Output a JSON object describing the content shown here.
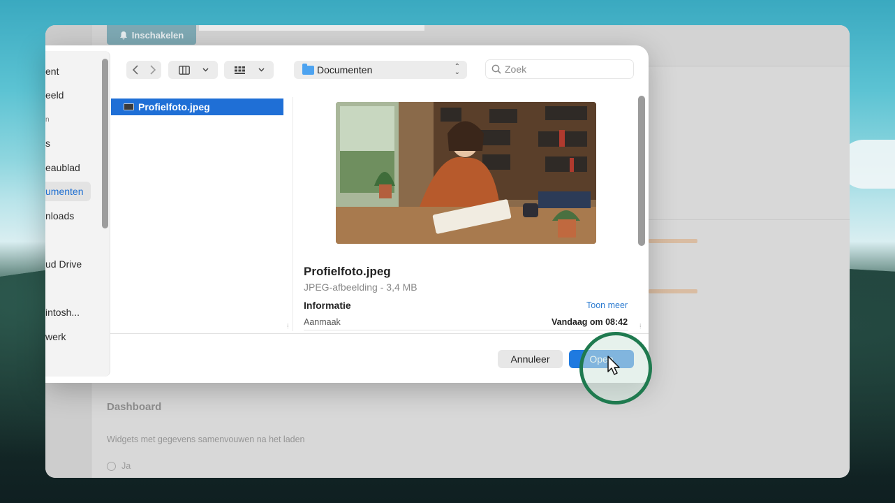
{
  "background_app": {
    "enable_button": "Inschakelen",
    "dashboard_title": "Dashboard",
    "dashboard_desc": "Widgets met gegevens samenvouwen na het laden",
    "radio_option": "Ja"
  },
  "dialog": {
    "sidebar": {
      "items": [
        {
          "label": "ent"
        },
        {
          "label": "eeld"
        },
        {
          "label": "n"
        },
        {
          "label": "s"
        },
        {
          "label": "eaublad"
        },
        {
          "label": "umenten",
          "active": true
        },
        {
          "label": "nloads"
        },
        {
          "label": "ud Drive"
        },
        {
          "label": "intosh..."
        },
        {
          "label": "werk"
        }
      ]
    },
    "toolbar": {
      "back_icon": "chevron-left-icon",
      "forward_icon": "chevron-right-icon",
      "view_icon": "columns-view-icon",
      "group_icon": "grid-icon"
    },
    "location": {
      "label": "Documenten"
    },
    "search": {
      "placeholder": "Zoek"
    },
    "files": [
      {
        "name": "Profielfoto.jpeg",
        "selected": true
      }
    ],
    "preview": {
      "name": "Profielfoto.jpeg",
      "type": "JPEG-afbeelding - 3,4 MB",
      "info_title": "Informatie",
      "more_link": "Toon meer",
      "meta_label": "Aanmaak",
      "meta_value": "Vandaag om 08:42"
    },
    "buttons": {
      "cancel": "Annuleer",
      "open": "Open"
    }
  },
  "colors": {
    "accent": "#1f7ae0",
    "highlight_ring": "#1f7a4f"
  }
}
